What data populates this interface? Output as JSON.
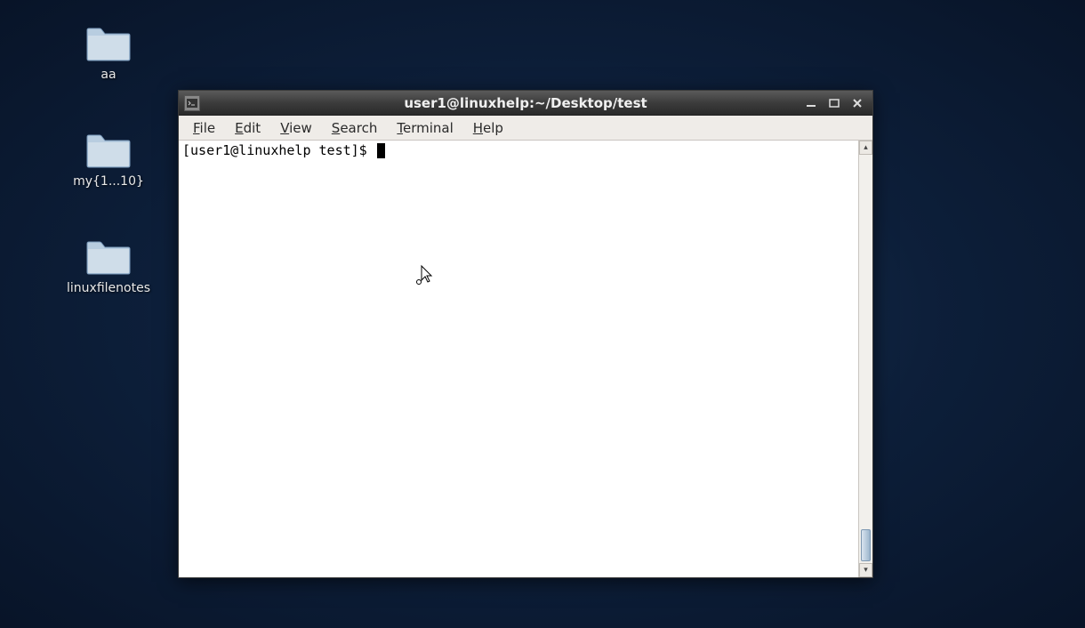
{
  "desktop": {
    "icons": [
      {
        "label": "aa"
      },
      {
        "label": "my{1...10}"
      },
      {
        "label": "linuxfilenotes"
      }
    ]
  },
  "terminal_window": {
    "title": "user1@linuxhelp:~/Desktop/test",
    "menu": {
      "file": "File",
      "edit": "Edit",
      "view": "View",
      "search": "Search",
      "terminal": "Terminal",
      "help": "Help"
    },
    "prompt": "[user1@linuxhelp test]$ "
  }
}
